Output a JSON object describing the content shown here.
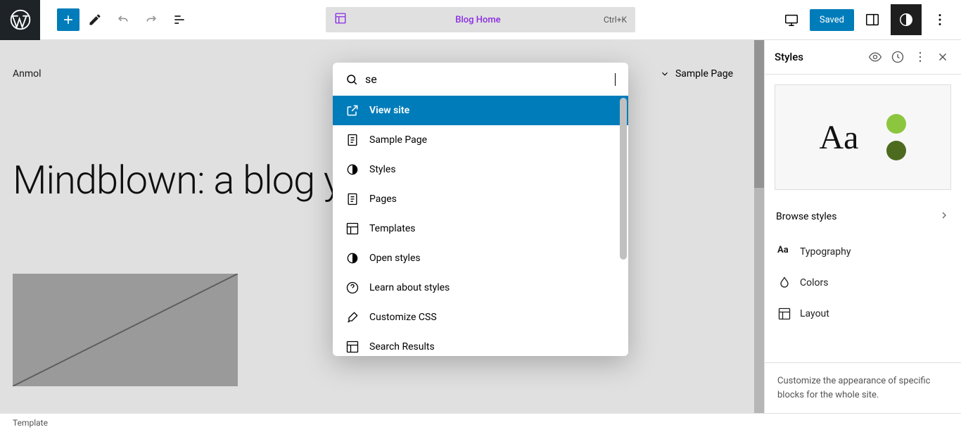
{
  "topbar": {
    "template_name": "Blog Home",
    "shortcut": "Ctrl+K",
    "save_label": "Saved"
  },
  "canvas": {
    "site_title": "Anmol",
    "nav_link": "Sample Page",
    "hero": "Mindblown: a blog                                 y."
  },
  "palette": {
    "search_value": "se",
    "items": [
      {
        "label": "View site",
        "icon": "external",
        "selected": true
      },
      {
        "label": "Sample Page",
        "icon": "page"
      },
      {
        "label": "Styles",
        "icon": "halfcircle"
      },
      {
        "label": "Pages",
        "icon": "page"
      },
      {
        "label": "Templates",
        "icon": "layout"
      },
      {
        "label": "Open styles",
        "icon": "halfcircle"
      },
      {
        "label": "Learn about styles",
        "icon": "help"
      },
      {
        "label": "Customize CSS",
        "icon": "brush"
      },
      {
        "label": "Search Results",
        "icon": "layout"
      }
    ]
  },
  "sidebar": {
    "title": "Styles",
    "preview_text": "Aa",
    "browse_label": "Browse styles",
    "items": [
      {
        "label": "Typography",
        "icon": "aa"
      },
      {
        "label": "Colors",
        "icon": "drop"
      },
      {
        "label": "Layout",
        "icon": "layout"
      }
    ],
    "footer": "Customize the appearance of specific blocks for the whole site."
  },
  "bottombar": {
    "breadcrumb": "Template"
  }
}
